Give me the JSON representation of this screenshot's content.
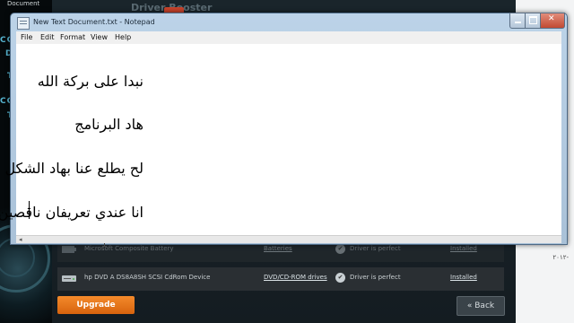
{
  "desktop": {
    "top_left_label": "Document",
    "side_text": [
      "CC",
      "DS",
      "T",
      "CC",
      "T"
    ],
    "right_number": "٢٠١٢-"
  },
  "driver_booster": {
    "title": "Driver Booster",
    "rows": [
      {
        "name": "Microsoft Composite Battery",
        "category": "Batteries",
        "status": "Driver is perfect",
        "action": "Installed"
      },
      {
        "name": "hp DVD A  DS8A8SH SCSI CdRom Device",
        "category": "DVD/CD-ROM drives",
        "status": "Driver is perfect",
        "action": "Installed"
      }
    ],
    "upgrade_label": "Upgrade",
    "back_label": "Back",
    "accent_color": "#e8741b"
  },
  "notepad": {
    "title": "New Text Document.txt - Notepad",
    "menu": [
      "File",
      "Edit",
      "Format",
      "View",
      "Help"
    ],
    "lines": [
      "نبدا على بركة الله",
      "هاد البرنامج",
      "لح يطلع عنا بهاد الشكل",
      "انا عندي تعريفان ناقصين نت"
    ]
  }
}
